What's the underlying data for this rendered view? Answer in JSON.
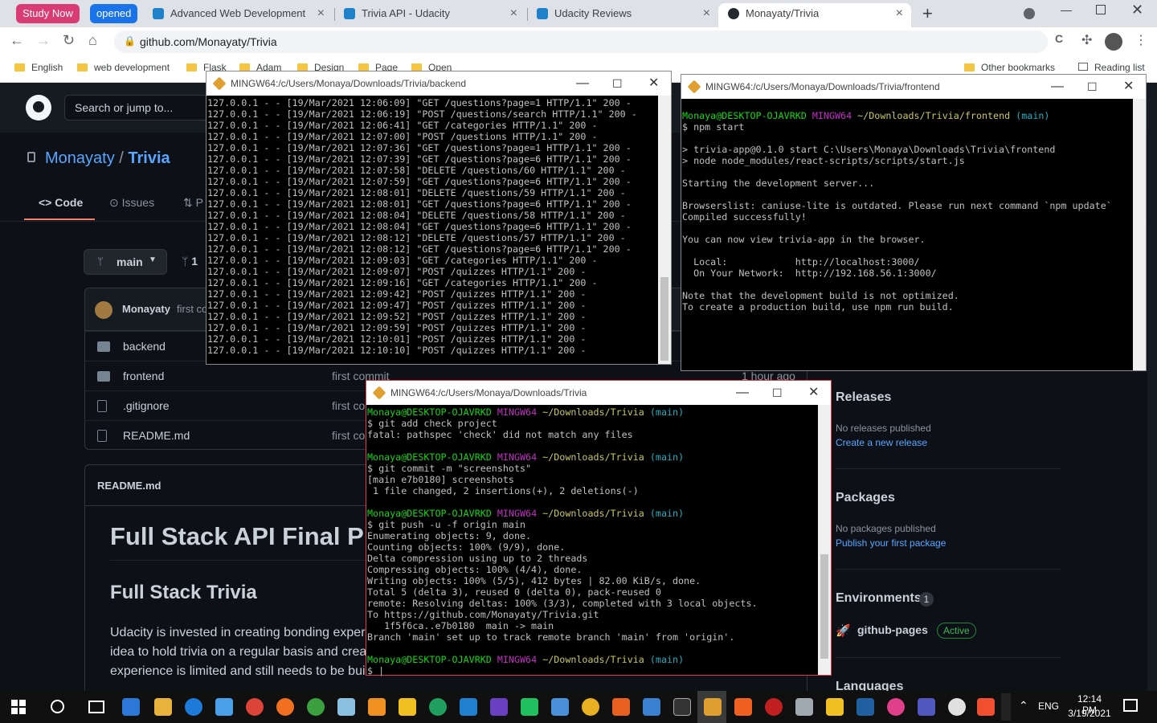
{
  "browser": {
    "tab_groups": [
      {
        "label": "Study Now",
        "color": "#d93c73"
      },
      {
        "label": "opened",
        "color": "#1a73e8"
      }
    ],
    "tabs": [
      {
        "title": "Advanced Web Development - U",
        "favicon_color": "#1f82c8"
      },
      {
        "title": "Trivia API - Udacity",
        "favicon_color": "#1f82c8"
      },
      {
        "title": "Udacity Reviews",
        "favicon_color": "#1f82c8"
      },
      {
        "title": "Monayaty/Trivia",
        "favicon_color": "#24292f"
      }
    ],
    "url": "github.com/Monayaty/Trivia",
    "bookmarks": [
      "English",
      "web development",
      "Flask",
      "Adam",
      "Design",
      "Page",
      "Open",
      "Other bookmarks",
      "Reading list"
    ]
  },
  "github": {
    "search_placeholder": "Search or jump to...",
    "owner": "Monayaty",
    "repo": "Trivia",
    "tabs": [
      "Code",
      "Issues",
      "P"
    ],
    "branch": "main",
    "branch_count": "1",
    "commit_author": "Monayaty",
    "commit_text": "first co",
    "files": [
      {
        "name": "backend",
        "type": "folder",
        "message": ""
      },
      {
        "name": "frontend",
        "type": "folder",
        "message": "first commit",
        "age": "1 hour ago"
      },
      {
        "name": ".gitignore",
        "type": "file",
        "message": "first co"
      },
      {
        "name": "README.md",
        "type": "file",
        "message": "first co"
      }
    ],
    "readme_label": "README.md",
    "readme_h1": "Full Stack API Final Pro",
    "readme_h2": "Full Stack Trivia",
    "readme_p1": "Udacity is invested in creating bonding exper",
    "readme_p2": "idea to hold trivia on a regular basis and crea",
    "readme_p3": "experience is limited and still needs to be bui",
    "sidebar": {
      "releases_title": "Releases",
      "releases_none": "No releases published",
      "releases_link": "Create a new release",
      "packages_title": "Packages",
      "packages_none": "No packages published",
      "packages_link": "Publish your first package",
      "env_title": "Environments",
      "env_count": "1",
      "env_name": "github-pages",
      "env_status": "Active",
      "languages_title": "Languages"
    }
  },
  "terminals": {
    "backend": {
      "title": "MINGW64:/c/Users/Monaya/Downloads/Trivia/backend",
      "lines": [
        "127.0.0.1 - - [19/Mar/2021 12:06:09] \"GET /questions?page=1 HTTP/1.1\" 200 -",
        "127.0.0.1 - - [19/Mar/2021 12:06:19] \"POST /questions/search HTTP/1.1\" 200 -",
        "127.0.0.1 - - [19/Mar/2021 12:06:41] \"GET /categories HTTP/1.1\" 200 -",
        "127.0.0.1 - - [19/Mar/2021 12:07:00] \"POST /questions HTTP/1.1\" 200 -",
        "127.0.0.1 - - [19/Mar/2021 12:07:36] \"GET /questions?page=1 HTTP/1.1\" 200 -",
        "127.0.0.1 - - [19/Mar/2021 12:07:39] \"GET /questions?page=6 HTTP/1.1\" 200 -",
        "127.0.0.1 - - [19/Mar/2021 12:07:58] \"DELETE /questions/60 HTTP/1.1\" 200 -",
        "127.0.0.1 - - [19/Mar/2021 12:07:59] \"GET /questions?page=6 HTTP/1.1\" 200 -",
        "127.0.0.1 - - [19/Mar/2021 12:08:01] \"DELETE /questions/59 HTTP/1.1\" 200 -",
        "127.0.0.1 - - [19/Mar/2021 12:08:01] \"GET /questions?page=6 HTTP/1.1\" 200 -",
        "127.0.0.1 - - [19/Mar/2021 12:08:04] \"DELETE /questions/58 HTTP/1.1\" 200 -",
        "127.0.0.1 - - [19/Mar/2021 12:08:04] \"GET /questions?page=6 HTTP/1.1\" 200 -",
        "127.0.0.1 - - [19/Mar/2021 12:08:12] \"DELETE /questions/57 HTTP/1.1\" 200 -",
        "127.0.0.1 - - [19/Mar/2021 12:08:12] \"GET /questions?page=6 HTTP/1.1\" 200 -",
        "127.0.0.1 - - [19/Mar/2021 12:09:03] \"GET /categories HTTP/1.1\" 200 -",
        "127.0.0.1 - - [19/Mar/2021 12:09:07] \"POST /quizzes HTTP/1.1\" 200 -",
        "127.0.0.1 - - [19/Mar/2021 12:09:16] \"GET /categories HTTP/1.1\" 200 -",
        "127.0.0.1 - - [19/Mar/2021 12:09:42] \"POST /quizzes HTTP/1.1\" 200 -",
        "127.0.0.1 - - [19/Mar/2021 12:09:47] \"POST /quizzes HTTP/1.1\" 200 -",
        "127.0.0.1 - - [19/Mar/2021 12:09:52] \"POST /quizzes HTTP/1.1\" 200 -",
        "127.0.0.1 - - [19/Mar/2021 12:09:59] \"POST /quizzes HTTP/1.1\" 200 -",
        "127.0.0.1 - - [19/Mar/2021 12:10:01] \"POST /quizzes HTTP/1.1\" 200 -",
        "127.0.0.1 - - [19/Mar/2021 12:10:10] \"POST /quizzes HTTP/1.1\" 200 -"
      ]
    },
    "frontend": {
      "title": "MINGW64:/c/Users/Monaya/Downloads/Trivia/frontend",
      "prompt_user": "Monaya@DESKTOP-OJAVRKD",
      "prompt_env": "MINGW64",
      "prompt_path": "~/Downloads/Trivia/frontend",
      "prompt_branch": "(main)",
      "lines": [
        "$ npm start",
        "",
        "> trivia-app@0.1.0 start C:\\Users\\Monaya\\Downloads\\Trivia\\frontend",
        "> node node_modules/react-scripts/scripts/start.js",
        "",
        "Starting the development server...",
        "",
        "Browserslist: caniuse-lite is outdated. Please run next command `npm update`",
        "Compiled successfully!",
        "",
        "You can now view trivia-app in the browser.",
        "",
        "  Local:            http://localhost:3000/",
        "  On Your Network:  http://192.168.56.1:3000/",
        "",
        "Note that the development build is not optimized.",
        "To create a production build, use npm run build."
      ]
    },
    "main": {
      "title": "MINGW64:/c/Users/Monaya/Downloads/Trivia",
      "prompt_user": "Monaya@DESKTOP-OJAVRKD",
      "prompt_env": "MINGW64",
      "prompt_path": "~/Downloads/Trivia",
      "prompt_branch": "(main)",
      "blocks": [
        [
          "$ git add check project",
          "fatal: pathspec 'check' did not match any files"
        ],
        [
          "$ git commit -m \"screenshots\"",
          "[main e7b0180] screenshots",
          " 1 file changed, 2 insertions(+), 2 deletions(-)"
        ],
        [
          "$ git push -u -f origin main",
          "Enumerating objects: 9, done.",
          "Counting objects: 100% (9/9), done.",
          "Delta compression using up to 2 threads",
          "Compressing objects: 100% (4/4), done.",
          "Writing objects: 100% (5/5), 412 bytes | 82.00 KiB/s, done.",
          "Total 5 (delta 3), reused 0 (delta 0), pack-reused 0",
          "remote: Resolving deltas: 100% (3/3), completed with 3 local objects.",
          "To https://github.com/Monayaty/Trivia.git",
          "   1f5f6ca..e7b0180  main -> main",
          "Branch 'main' set up to track remote branch 'main' from 'origin'."
        ]
      ],
      "final_prompt": "$ "
    }
  },
  "taskbar": {
    "lang": "ENG",
    "time": "12:14 PM",
    "date": "3/19/2021"
  }
}
